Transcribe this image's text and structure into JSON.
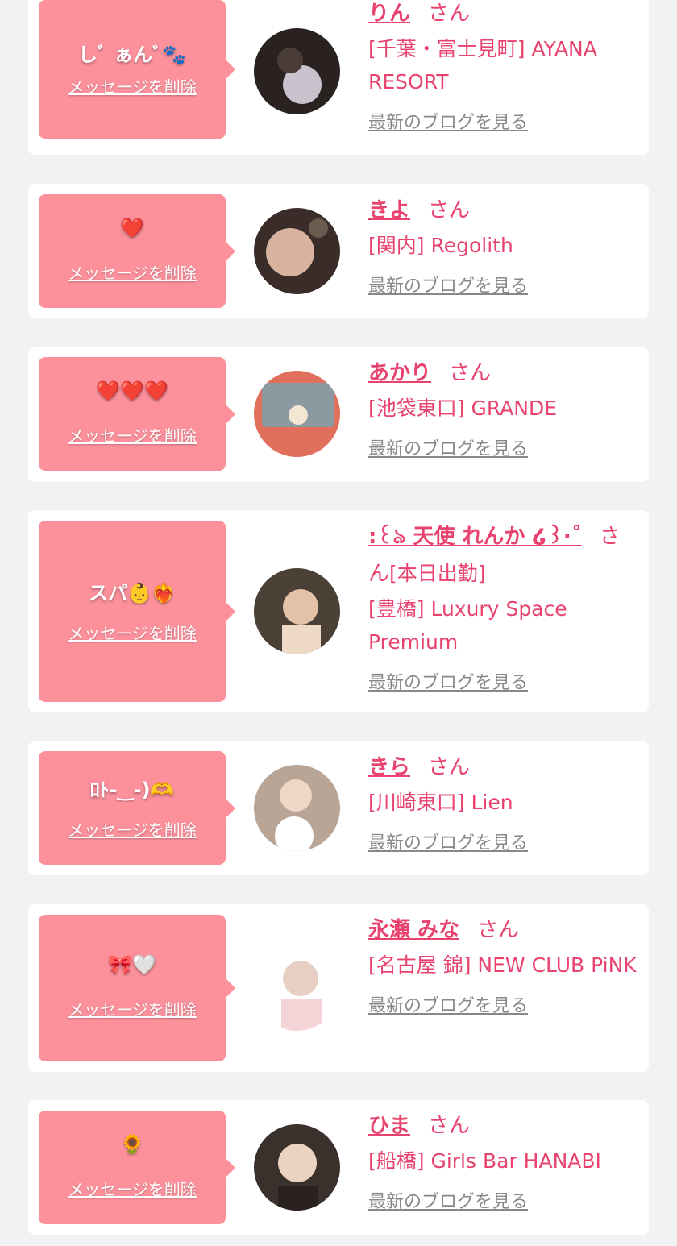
{
  "colors": {
    "background": "#f2f2f2",
    "card": "#ffffff",
    "bubble": "#fc919c",
    "accent": "#e8436f",
    "link_gray": "#888888"
  },
  "labels": {
    "delete": "メッセージを削除",
    "honorific": "さん",
    "blog": "最新のブログを見る"
  },
  "entries": [
    {
      "message": "しﾞ ぁんﾞ🐾",
      "name": "りん",
      "shop": "[千葉・富士見町] AYANA RESORT",
      "avatar": "avatar-photo"
    },
    {
      "message": "❤️",
      "name": "きよ",
      "shop": "[関内] Regolith",
      "avatar": "avatar-photo"
    },
    {
      "message": "❤️❤️❤️",
      "name": "あかり",
      "shop": "[池袋東口] GRANDE",
      "avatar": "avatar-photo"
    },
    {
      "message": "スパ👶❤️‍🔥",
      "name": ":꒰ঌ 天使 れんか ໒꒱·˚",
      "shop": "[本日出勤]",
      "shop2": "[豊橋] Luxury Space Premium",
      "avatar": "avatar-photo"
    },
    {
      "message": "ﾛﾄ-‿-)🫶",
      "name": "きら",
      "shop": "[川崎東口] Lien",
      "avatar": "avatar-photo"
    },
    {
      "message": "🎀🤍",
      "name": "永瀬 みな",
      "shop": "[名古屋 錦] NEW CLUB PiNK",
      "avatar": "avatar-photo"
    },
    {
      "message": "🌻",
      "name": "ひま",
      "shop": "[船橋] Girls Bar HANABI",
      "avatar": "avatar-photo"
    }
  ]
}
